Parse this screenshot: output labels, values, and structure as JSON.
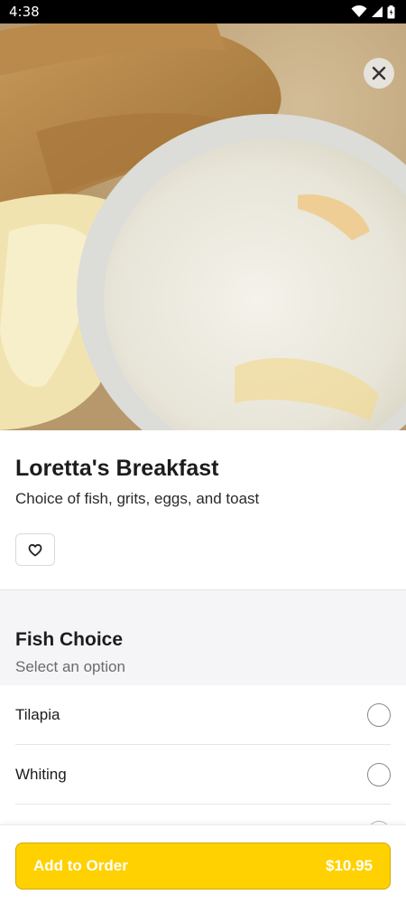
{
  "status": {
    "time": "4:38"
  },
  "item": {
    "title": "Loretta's Breakfast",
    "description": "Choice of fish, grits, eggs, and toast"
  },
  "section": {
    "title": "Fish Choice",
    "subtitle": "Select an option",
    "options": [
      "Tilapia",
      "Whiting"
    ]
  },
  "cart": {
    "add_label": "Add to Order",
    "price": "$10.95"
  },
  "colors": {
    "accent": "#ffd100",
    "accent_border": "#d4a900",
    "section_bg": "#f5f5f7"
  },
  "icons": {
    "close": "close-icon",
    "favorite": "heart-icon",
    "wifi": "wifi-icon",
    "signal": "signal-icon",
    "battery": "battery-icon"
  }
}
